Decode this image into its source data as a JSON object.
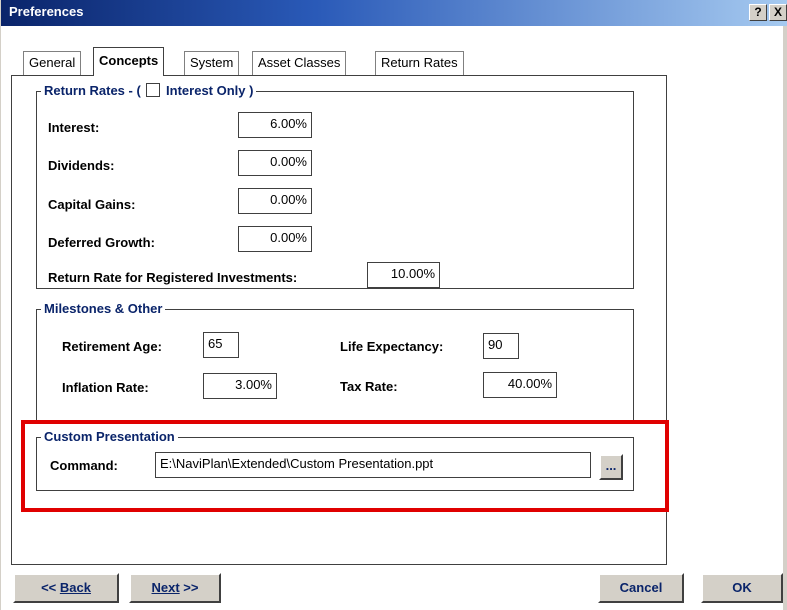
{
  "window": {
    "title": "Preferences",
    "help_label": "?",
    "close_label": "X"
  },
  "tabs": [
    {
      "label": "General",
      "active": false
    },
    {
      "label": "Concepts",
      "active": true
    },
    {
      "label": "System",
      "active": false
    },
    {
      "label": "Asset Classes",
      "active": false
    },
    {
      "label": "Return Rates",
      "active": false
    }
  ],
  "return_rates": {
    "legend_prefix": "Return Rates - (",
    "interest_only_label": "Interest Only",
    "legend_suffix": ")",
    "interest_only_checked": false,
    "interest_label": "Interest:",
    "interest_value": "6.00%",
    "dividends_label": "Dividends:",
    "dividends_value": "0.00%",
    "capital_gains_label": "Capital Gains:",
    "capital_gains_value": "0.00%",
    "deferred_growth_label": "Deferred Growth:",
    "deferred_growth_value": "0.00%",
    "registered_label": "Return Rate for Registered Investments:",
    "registered_value": "10.00%"
  },
  "milestones": {
    "legend": "Milestones & Other",
    "retirement_age_label": "Retirement Age:",
    "retirement_age_value": "65",
    "life_expectancy_label": "Life Expectancy:",
    "life_expectancy_value": "90",
    "inflation_rate_label": "Inflation Rate:",
    "inflation_rate_value": "3.00%",
    "tax_rate_label": "Tax Rate:",
    "tax_rate_value": "40.00%"
  },
  "custom_presentation": {
    "legend": "Custom Presentation",
    "command_label": "Command:",
    "command_value": "E:\\NaviPlan\\Extended\\Custom Presentation.ppt",
    "browse_label": "..."
  },
  "buttons": {
    "back_prefix": "<< ",
    "back_label": "Back",
    "next_label": "Next",
    "next_suffix": " >>",
    "cancel_label": "Cancel",
    "ok_label": "OK"
  },
  "colors": {
    "highlight": "#e00000",
    "legend_text": "#0a246a",
    "title_bar": "#0a246a"
  }
}
